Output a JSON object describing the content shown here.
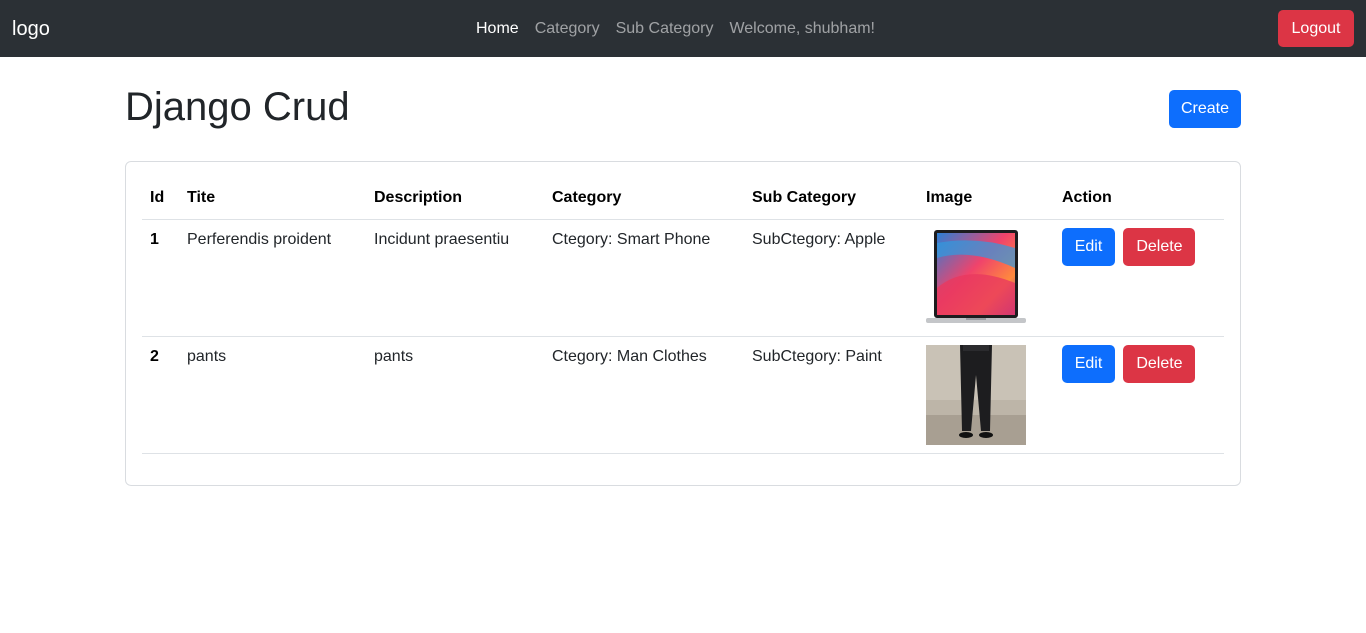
{
  "navbar": {
    "brand": "logo",
    "links": [
      {
        "label": "Home",
        "active": true
      },
      {
        "label": "Category",
        "active": false
      },
      {
        "label": "Sub Category",
        "active": false
      }
    ],
    "welcome": "Welcome, shubham!",
    "logout_label": "Logout"
  },
  "page": {
    "title": "Django Crud",
    "create_label": "Create"
  },
  "table": {
    "headers": [
      "Id",
      "Tite",
      "Description",
      "Category",
      "Sub Category",
      "Image",
      "Action"
    ],
    "rows": [
      {
        "id": "1",
        "title": "Perferendis proident",
        "description": "Incidunt praesentiu",
        "category": "Ctegory: Smart Phone",
        "subcategory": "SubCtegory: Apple",
        "image": "laptop-image",
        "edit_label": "Edit",
        "delete_label": "Delete"
      },
      {
        "id": "2",
        "title": "pants",
        "description": "pants",
        "category": "Ctegory: Man Clothes",
        "subcategory": "SubCtegory: Paint",
        "image": "pants-image",
        "edit_label": "Edit",
        "delete_label": "Delete"
      }
    ]
  },
  "colors": {
    "navbar_bg": "#2b3035",
    "primary": "#0d6efd",
    "danger": "#dc3545"
  }
}
